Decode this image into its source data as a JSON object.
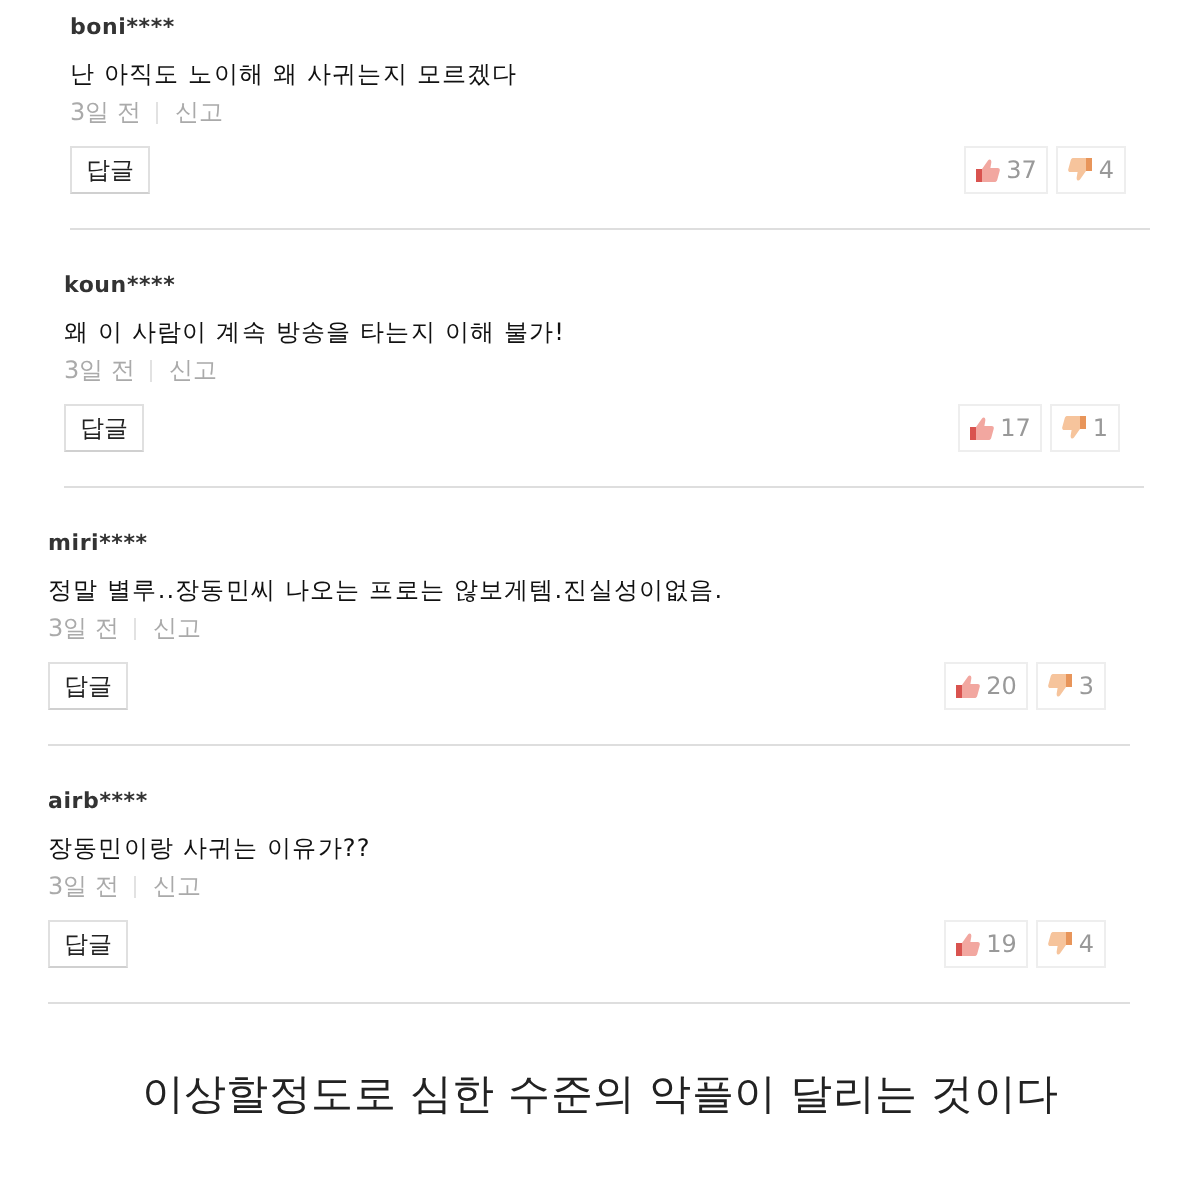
{
  "comments": [
    {
      "username": "boni****",
      "text": "난 아직도 노이해 왜 사귀는지 모르겠다",
      "time": "3일 전",
      "report": "신고",
      "reply_button": "답글",
      "likes": "37",
      "dislikes": "4"
    },
    {
      "username": "koun****",
      "text": "왜 이 사람이 계속 방송을 타는지 이해 불가!",
      "time": "3일 전",
      "report": "신고",
      "reply_button": "답글",
      "likes": "17",
      "dislikes": "1"
    },
    {
      "username": "miri****",
      "text": "정말 별루..장동민씨 나오는 프로는 않보게템.진실성이없음.",
      "time": "3일 전",
      "report": "신고",
      "reply_button": "답글",
      "likes": "20",
      "dislikes": "3"
    },
    {
      "username": "airb****",
      "text": "장동민이랑 사귀는 이유가??",
      "time": "3일 전",
      "report": "신고",
      "reply_button": "답글",
      "likes": "19",
      "dislikes": "4"
    }
  ],
  "caption": "이상할정도로 심한 수준의 악플이 달리는 것이다"
}
